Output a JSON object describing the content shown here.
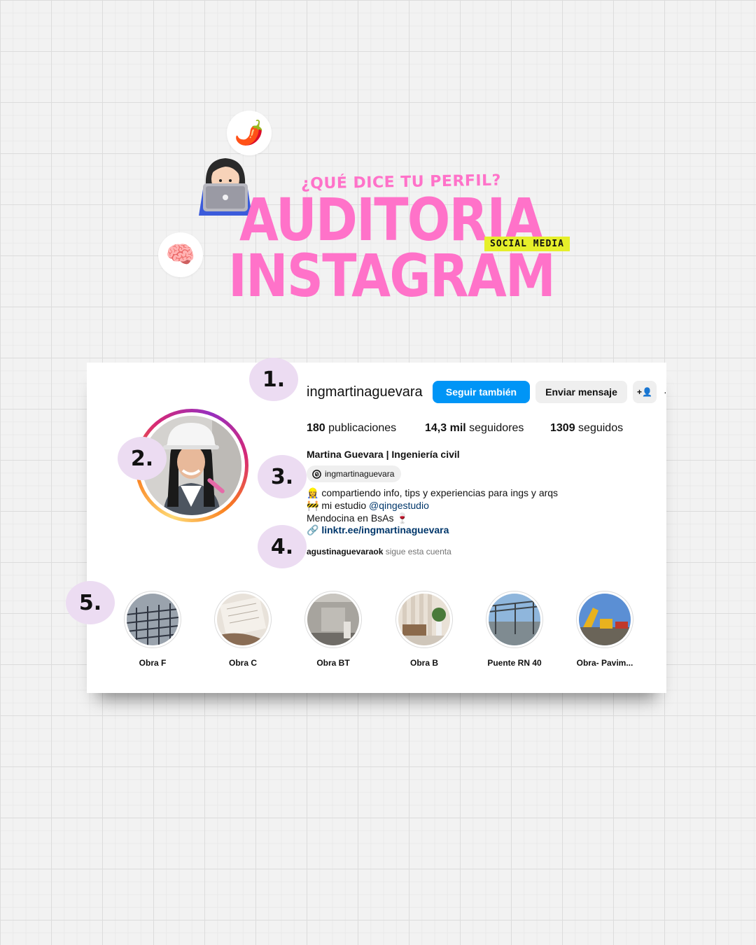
{
  "header": {
    "subtitle": "¿QUÉ DICE TU PERFIL?",
    "title_line1": "AUDITORIA",
    "title_line2": "INSTAGRAM",
    "tag": "SOCIAL MEDIA",
    "emojis": {
      "chili": "🌶️",
      "brain": "🧠"
    },
    "icons": [
      "chili-icon",
      "laptop-girl-icon",
      "brain-icon"
    ],
    "accent_color": "#ff72c9",
    "tag_color": "#e6ef2a"
  },
  "markers": [
    "1.",
    "2.",
    "3.",
    "4.",
    "5."
  ],
  "profile": {
    "username": "ingmartinaguevara",
    "follow_label": "Seguir también",
    "message_label": "Enviar mensaje",
    "add_label": "+👤",
    "more_label": "·",
    "stats": {
      "posts_count": "180",
      "posts_label": "publicaciones",
      "followers_count": "14,3 mil",
      "followers_label": "seguidores",
      "following_count": "1309",
      "following_label": "seguidos"
    },
    "display_name": "Martina Guevara | Ingeniería civil",
    "threads_handle": "ingmartinaguevara",
    "bio_line1_emoji": "👷‍♀️",
    "bio_line1": "compartiendo info, tips y experiencias para ings y arqs",
    "bio_line2_emoji": "🚧",
    "bio_line2_prefix": "mi estudio",
    "bio_line2_mention": "@qingestudio",
    "bio_line3": "Mendocina en BsAs 🍷",
    "link": "linktr.ee/ingmartinaguevara",
    "followed_by_user": "agustinaguevaraok",
    "followed_by_text": "sigue esta cuenta",
    "follow_color": "#0095f6"
  },
  "highlights": [
    {
      "label": "Obra F"
    },
    {
      "label": "Obra C"
    },
    {
      "label": "Obra BT"
    },
    {
      "label": "Obra B"
    },
    {
      "label": "Puente RN 40"
    },
    {
      "label": "Obra- Pavim..."
    }
  ]
}
